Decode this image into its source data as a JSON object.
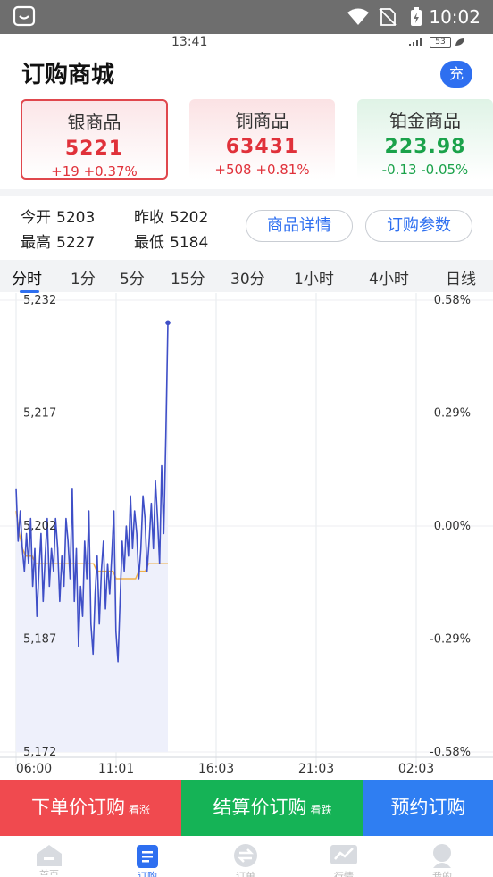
{
  "system": {
    "time": "10:02"
  },
  "inner_status": {
    "time": "13:41",
    "battery": "53"
  },
  "header": {
    "title": "订购商城",
    "charge_label": "充"
  },
  "products": [
    {
      "name": "银商品",
      "price": "5221",
      "change": "+19 +0.37%",
      "trend": "up"
    },
    {
      "name": "铜商品",
      "price": "63431",
      "change": "+508 +0.81%",
      "trend": "up"
    },
    {
      "name": "铂金商品",
      "price": "223.98",
      "change": "-0.13 -0.05%",
      "trend": "down"
    }
  ],
  "stats": {
    "open_label": "今开",
    "open": "5203",
    "prev_close_label": "昨收",
    "prev_close": "5202",
    "high_label": "最高",
    "high": "5227",
    "low_label": "最低",
    "low": "5184"
  },
  "buttons": {
    "details": "商品详情",
    "params": "订购参数"
  },
  "tabs": [
    "分时",
    "1分",
    "5分",
    "15分",
    "30分",
    "1小时",
    "4小时",
    "日线"
  ],
  "chart_data": {
    "type": "line",
    "left_ticks": [
      "5,232",
      "5,217",
      "5,202",
      "5,187",
      "5,172"
    ],
    "right_ticks": [
      "0.58%",
      "0.29%",
      "0.00%",
      "-0.29%",
      "-0.58%"
    ],
    "x_ticks": [
      "06:00",
      "11:01",
      "16:03",
      "21:03",
      "02:03"
    ],
    "ylim": [
      5172,
      5232
    ],
    "xlim": [
      0,
      100
    ],
    "series": [
      {
        "values": [
          5207,
          5200,
          5204,
          5199,
          5196,
          5201,
          5197,
          5203,
          5194,
          5199,
          5190,
          5196,
          5201,
          5192,
          5198,
          5203,
          5194,
          5199,
          5196,
          5203,
          5199,
          5192,
          5198,
          5194,
          5203,
          5200,
          5195,
          5207,
          5192,
          5199,
          5186,
          5194,
          5190,
          5200,
          5195,
          5204,
          5189,
          5185,
          5193,
          5198,
          5189,
          5196,
          5200,
          5191,
          5197,
          5193,
          5198,
          5204,
          5188,
          5184,
          5192,
          5200,
          5196,
          5202,
          5198,
          5206,
          5199,
          5204,
          5201,
          5195,
          5199,
          5206,
          5203,
          5196,
          5200,
          5205,
          5199,
          5208,
          5203,
          5197,
          5210,
          5201,
          5214,
          5229
        ]
      },
      {
        "values": [
          5204,
          5201,
          5199,
          5198,
          5198,
          5198,
          5197,
          5197,
          5197,
          5197,
          5197,
          5197,
          5197,
          5197,
          5197,
          5197,
          5197,
          5197,
          5197,
          5197,
          5197,
          5197,
          5197,
          5197,
          5197,
          5196,
          5196,
          5196,
          5196,
          5196,
          5196,
          5195,
          5195,
          5195,
          5195,
          5195,
          5195,
          5195,
          5196,
          5196,
          5196,
          5197,
          5197,
          5197,
          5197,
          5197,
          5197,
          5197
        ]
      }
    ],
    "colors": {
      "price": "#3f4fc7",
      "average": "#f0b14a",
      "fill": "#eef0fb"
    }
  },
  "actions": {
    "order_price": "下单价订购",
    "order_price_tag": "看涨",
    "settle_price": "结算价订购",
    "settle_price_tag": "看跌",
    "reserve": "预约订购"
  },
  "nav": [
    "首页",
    "订购",
    "订单",
    "行情",
    "我的"
  ]
}
